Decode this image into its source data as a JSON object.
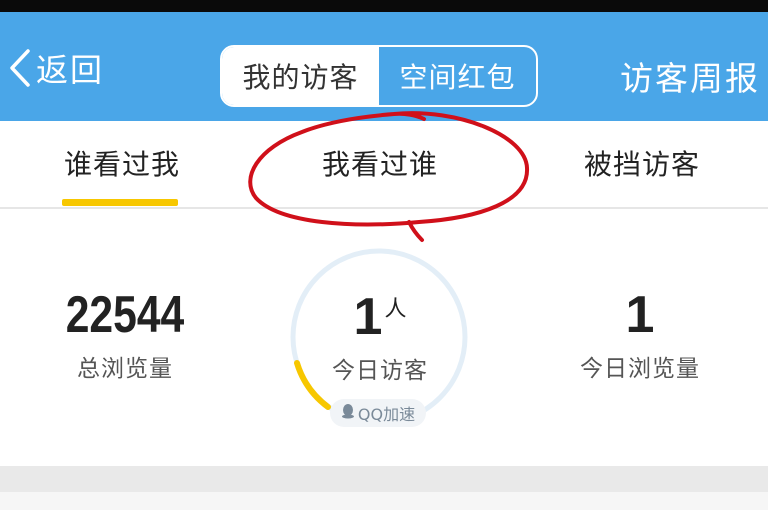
{
  "nav": {
    "back_label": "返回",
    "segments": [
      {
        "label": "我的访客",
        "active": true
      },
      {
        "label": "空间红包",
        "active": false
      }
    ],
    "weekly_label": "访客周报"
  },
  "tabs": [
    {
      "label": "谁看过我",
      "active": true
    },
    {
      "label": "我看过谁",
      "active": false
    },
    {
      "label": "被挡访客",
      "active": false
    }
  ],
  "stats": {
    "total_views": {
      "value": "22544",
      "label": "总浏览量"
    },
    "today_visitors": {
      "value": "1",
      "unit": "人",
      "label": "今日访客",
      "badge": "QQ加速"
    },
    "today_views": {
      "value": "1",
      "label": "今日浏览量"
    }
  },
  "colors": {
    "nav_bg": "#4aa6e8",
    "tab_indicator": "#f7c700",
    "ring_track": "#e3eef7",
    "ring_progress": "#f7c700",
    "annotation": "#d0101a"
  },
  "icons": {
    "back": "chevron-left-icon",
    "badge": "qq-penguin-icon"
  }
}
